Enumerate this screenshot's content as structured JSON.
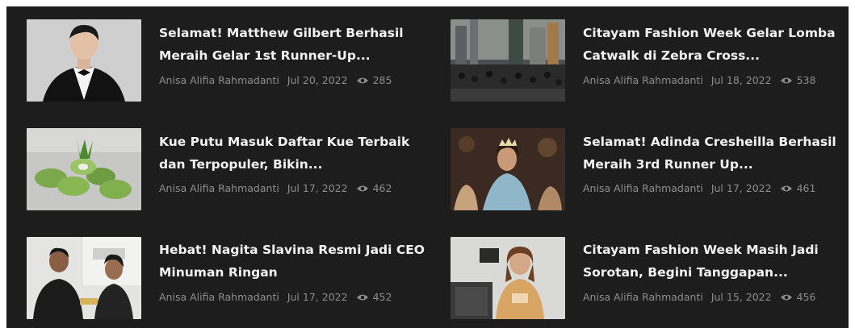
{
  "articles": [
    {
      "title_line1": "Selamat! Matthew Gilbert Berhasil",
      "title_line2": "Meraih Gelar 1st Runner-Up...",
      "author": "Anisa Alifia Rahmadanti",
      "date": "Jul 20, 2022",
      "views": "285",
      "thumb": "man-in-tuxedo"
    },
    {
      "title_line1": "Citayam Fashion Week Gelar Lomba",
      "title_line2": "Catwalk di Zebra Cross...",
      "author": "Anisa Alifia Rahmadanti",
      "date": "Jul 18, 2022",
      "views": "538",
      "thumb": "city-crowd"
    },
    {
      "title_line1": "Kue Putu Masuk Daftar Kue Terbaik",
      "title_line2": "dan Terpopuler, Bikin...",
      "author": "Anisa Alifia Rahmadanti",
      "date": "Jul 17, 2022",
      "views": "462",
      "thumb": "green-cakes"
    },
    {
      "title_line1": "Selamat! Adinda Cresheilla Berhasil",
      "title_line2": "Meraih 3rd Runner Up...",
      "author": "Anisa Alifia Rahmadanti",
      "date": "Jul 17, 2022",
      "views": "461",
      "thumb": "pageant-winner"
    },
    {
      "title_line1": "Hebat! Nagita Slavina Resmi Jadi CEO",
      "title_line2": "Minuman Ringan",
      "author": "Anisa Alifia Rahmadanti",
      "date": "Jul 17, 2022",
      "views": "452",
      "thumb": "two-people-event"
    },
    {
      "title_line1": "Citayam Fashion Week Masih Jadi",
      "title_line2": "Sorotan, Begini Tanggapan...",
      "author": "Anisa Alifia Rahmadanti",
      "date": "Jul 15, 2022",
      "views": "456",
      "thumb": "woman-smiling"
    }
  ],
  "colors": {
    "background": "#1d1d1d",
    "title": "#f2f2f2",
    "meta": "#8d8d8d"
  },
  "icons": {
    "views": "eye-icon"
  }
}
